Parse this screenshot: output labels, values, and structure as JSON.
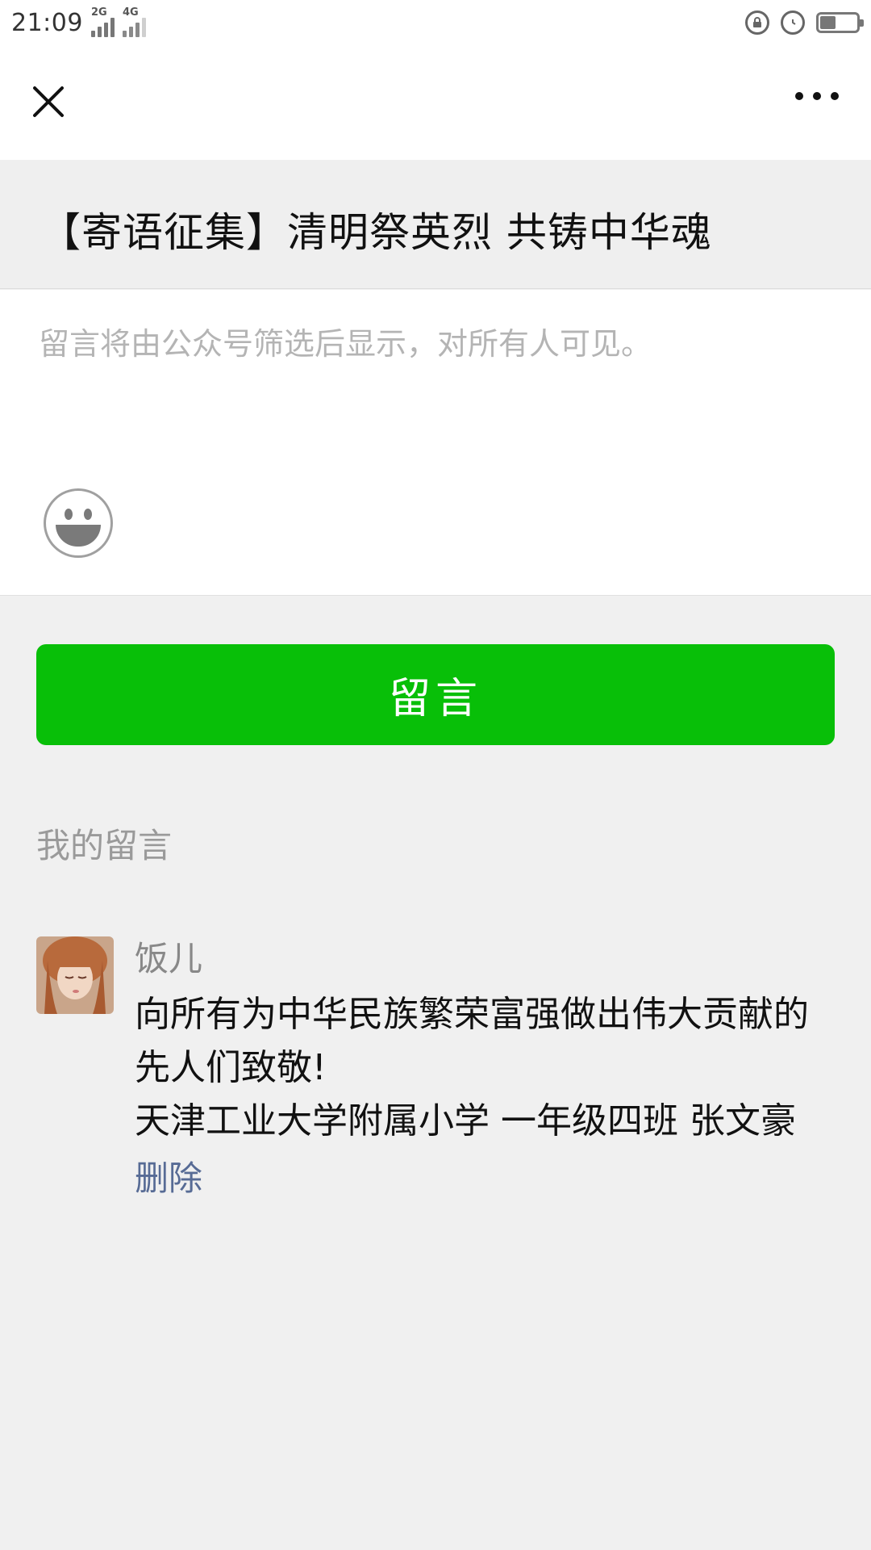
{
  "status_bar": {
    "time": "21:09",
    "sim1_tag": "2G",
    "sim2_tag": "4G",
    "icons": [
      "rotation-lock-icon",
      "alarm-icon",
      "battery-icon"
    ],
    "battery_level": 0.44
  },
  "nav": {
    "close_icon": "close-icon",
    "more_icon": "more-icon"
  },
  "article": {
    "title": "【寄语征集】清明祭英烈 共铸中华魂"
  },
  "editor": {
    "placeholder": "留言将由公众号筛选后显示，对所有人可见。",
    "value": "",
    "emoji_icon": "emoji-icon"
  },
  "submit": {
    "label": "留言",
    "color": "#08bf08"
  },
  "my_comments": {
    "section_label": "我的留言",
    "items": [
      {
        "author": "饭儿",
        "text": "向所有为中华民族繁荣富强做出伟大贡献的先人们致敬!\n天津工业大学附属小学 一年级四班 张文豪",
        "delete_label": "删除"
      }
    ]
  },
  "colors": {
    "accent_green": "#08bf08",
    "link_blue": "#576b95",
    "background": "#f0f0f0"
  }
}
